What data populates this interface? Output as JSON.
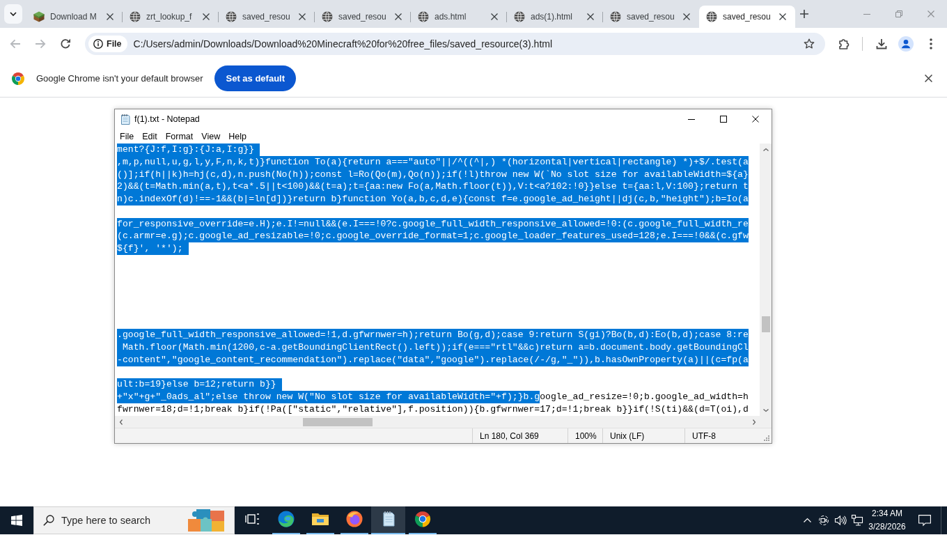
{
  "browser": {
    "tabs": [
      {
        "title": "Download M",
        "kind": "image",
        "selected": false
      },
      {
        "title": "zrt_lookup_f",
        "kind": "globe",
        "selected": false
      },
      {
        "title": "saved_resou",
        "kind": "globe",
        "selected": false
      },
      {
        "title": "saved_resou",
        "kind": "globe",
        "selected": false
      },
      {
        "title": "ads.html",
        "kind": "globe",
        "selected": false
      },
      {
        "title": "ads(1).html",
        "kind": "globe",
        "selected": false
      },
      {
        "title": "saved_resou",
        "kind": "globe",
        "selected": false
      },
      {
        "title": "saved_resou",
        "kind": "globe",
        "selected": true
      }
    ],
    "nav": [
      {
        "kind": "back",
        "disabled": true
      },
      {
        "kind": "forward",
        "disabled": true
      },
      {
        "kind": "reload",
        "disabled": false
      }
    ],
    "address_bar": {
      "chip": "File",
      "url": "C:/Users/admin/Downloads/Download%20Minecraft%20for%20free_files/saved_resource(3).html"
    },
    "infobar": {
      "message": "Google Chrome isn't your default browser",
      "button": "Set as default"
    }
  },
  "notepad": {
    "title": "f(1).txt - Notepad",
    "menu": [
      "File",
      "Edit",
      "Format",
      "View",
      "Help"
    ],
    "lines": [
      {
        "segments": [
          {
            "text": "ment?{J:f,I:g}:{J:a,I:g}}",
            "selected": true
          }
        ],
        "break_selected": true
      },
      {
        "segments": [
          {
            "text": ",m,p,null,u,g,l,y,F,n,k,t)}function To(a){return a===\"auto\"||/^((^|,) *(horizontal|vertical|rectangle) *)+$/.test(a",
            "selected": true
          }
        ]
      },
      {
        "segments": [
          {
            "text": "()];if(h||k)h=hj(c,d),n.push(No(h));const l=Ro(Qo(m),Qo(n));if(!l)throw new W(`No slot size for availableWidth=${a}",
            "selected": true
          }
        ]
      },
      {
        "segments": [
          {
            "text": "2)&&(t=Math.min(a,t),t<a*.5||t<100)&&(t=a);t={aa:new Fo(a,Math.floor(t)),V:t<a?102:!0}}else t={aa:l,V:100};return t",
            "selected": true
          }
        ]
      },
      {
        "segments": [
          {
            "text": "n)c.indexOf(d)!==-1&&(b|=ln[d])}return b}function Yo(a,b,c,d,e){const f=e.google_ad_height||dj(c,b,\"height\");b=Io(a",
            "selected": true
          }
        ]
      },
      {
        "break_selected": false
      },
      {
        "segments": [
          {
            "text": "for_responsive_override=e.H);e.I!=null&&(e.I===!0?c.google_full_width_responsive_allowed=!0:(c.google_full_width_re",
            "selected": true
          }
        ]
      },
      {
        "segments": [
          {
            "text": "(c.armr=e.g);c.google_ad_resizable=!0;c.google_override_format=1;c.google_loader_features_used=128;e.I===!0&&(c.gfw",
            "selected": true
          }
        ]
      },
      {
        "segments": [
          {
            "text": "${f}', '*');",
            "selected": true
          }
        ],
        "break_selected": true
      },
      {
        "break_selected": false
      },
      {
        "break_selected": false
      },
      {
        "break_selected": false
      },
      {
        "break_selected": false
      },
      {
        "break_selected": false
      },
      {
        "break_selected": false
      },
      {
        "segments": [
          {
            "text": ".google_full_width_responsive_allowed=!1,d.gfwrnwer=h);return Bo(g,d);case 9:return S(gi)?Bo(b,d):Eo(b,d);case 8:re",
            "selected": true
          }
        ]
      },
      {
        "segments": [
          {
            "text": " Math.floor(Math.min(1200,c-a.getBoundingClientRect().left));if(e===\"rtl\"&&c)return a=b.document.body.getBoundingCl",
            "selected": true
          }
        ]
      },
      {
        "segments": [
          {
            "text": "-content\",\"google_content_recommendation\").replace(\"data\",\"google\").replace(/-/g,\"_\")),b.hasOwnProperty(a)||(c=fp(a",
            "selected": true
          }
        ]
      },
      {
        "break_selected": false
      },
      {
        "segments": [
          {
            "text": "ult:b=19}else b=12;return b}}",
            "selected": true
          }
        ],
        "break_selected": true
      },
      {
        "segments": [
          {
            "text": "+\"x\"+g+\"_0ads_al\";else throw new W(\"No slot size for availableWidth=\"+f);}b.g",
            "selected": true
          },
          {
            "text": "oogle_ad_resize=!0;b.google_ad_width=h",
            "selected": false
          }
        ]
      },
      {
        "segments": [
          {
            "text": "fwrnwer=18;d=!1;break b}if(!Pa([\"static\",\"relative\"],f.position)){b.gfwrnwer=17;d=!1;break b}}if(!S(ti)&&(d=T(oi),d",
            "selected": false
          }
        ]
      }
    ],
    "status": [
      "Ln 180, Col 369",
      "100%",
      "Unix (LF)",
      "UTF-8"
    ]
  },
  "taskbar": {
    "search": {
      "placeholder": "Type here to search"
    },
    "apps": [
      {
        "kind": "taskview",
        "running": false,
        "selected": false
      },
      {
        "kind": "edge",
        "running": true,
        "selected": false
      },
      {
        "kind": "explorer",
        "running": true,
        "selected": false
      },
      {
        "kind": "firefox",
        "running": true,
        "selected": false
      },
      {
        "kind": "notepad",
        "running": true,
        "selected": true
      },
      {
        "kind": "chrome",
        "running": true,
        "selected": false
      }
    ],
    "clock": {
      "time": "2:34 AM",
      "date": "3/28/2026"
    }
  }
}
